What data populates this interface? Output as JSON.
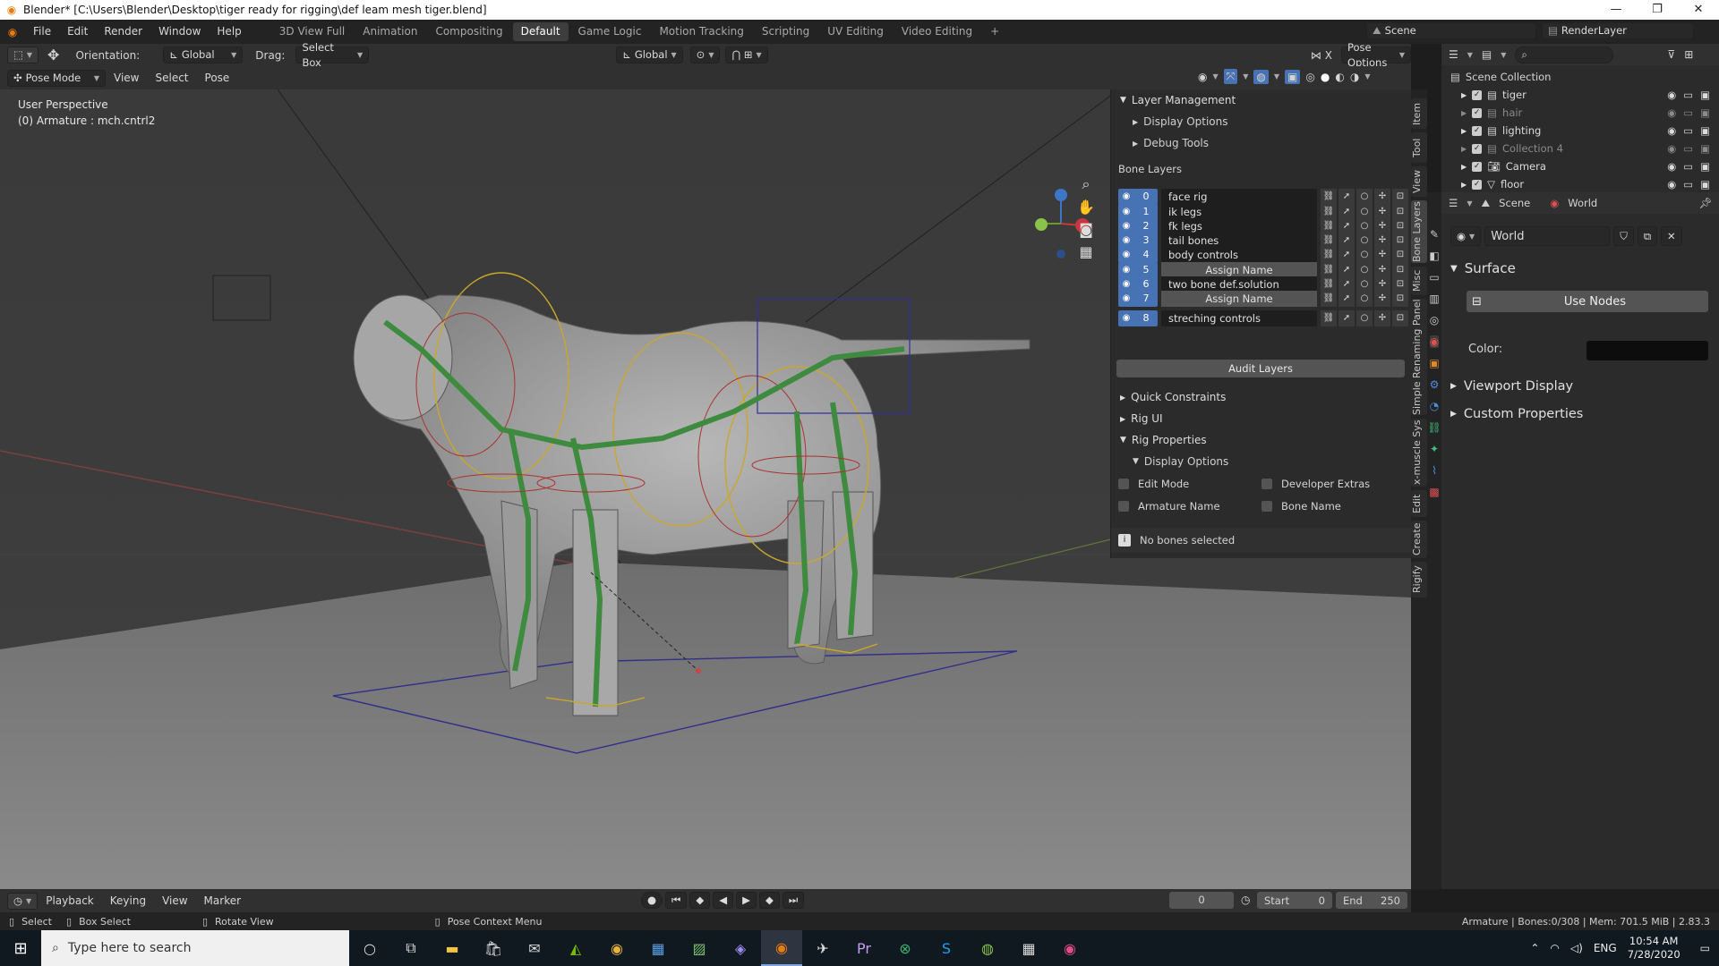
{
  "window": {
    "title": "Blender* [C:\\Users\\Blender\\Desktop\\tiger ready for rigging\\def leam mesh tiger.blend]",
    "minimize": "—",
    "maximize": "❐",
    "close": "✕"
  },
  "menu": [
    "File",
    "Edit",
    "Render",
    "Window",
    "Help"
  ],
  "workspaces": [
    "3D View Full",
    "Animation",
    "Compositing",
    "Default",
    "Game Logic",
    "Motion Tracking",
    "Scripting",
    "UV Editing",
    "Video Editing"
  ],
  "active_workspace": "Default",
  "scene_selector": {
    "scene": "Scene",
    "view_layer": "RenderLayer"
  },
  "tool_header": {
    "orientation_label": "Orientation:",
    "orientation_value": "Global",
    "drag_label": "Drag:",
    "drag_value": "Select Box",
    "transform_orientation": "Global",
    "pose_options": "Pose Options"
  },
  "mode_header": {
    "mode": "Pose Mode",
    "view": "View",
    "select": "Select",
    "pose": "Pose"
  },
  "viewport": {
    "perspective": "User Perspective",
    "active": "(0) Armature : mch.cntrl2"
  },
  "n_panel": {
    "layer_management": "Layer Management",
    "display_options": "Display Options",
    "debug_tools": "Debug Tools",
    "bone_layers_title": "Bone Layers",
    "layers": [
      {
        "num": "0",
        "name": "face rig",
        "assign": false
      },
      {
        "num": "1",
        "name": "ik legs",
        "assign": false
      },
      {
        "num": "2",
        "name": "fk legs",
        "assign": false
      },
      {
        "num": "3",
        "name": "tail bones",
        "assign": false
      },
      {
        "num": "4",
        "name": "body controls",
        "assign": false
      },
      {
        "num": "5",
        "name": "Assign Name",
        "assign": true
      },
      {
        "num": "6",
        "name": "two bone def.solution",
        "assign": false
      },
      {
        "num": "7",
        "name": "Assign Name",
        "assign": true
      },
      {
        "num": "8",
        "name": "streching controls",
        "assign": false
      }
    ],
    "audit_layers": "Audit Layers",
    "quick_constraints": "Quick Constraints",
    "rig_ui": "Rig UI",
    "rig_properties": "Rig Properties",
    "rig_display_options": "Display Options",
    "edit_mode": "Edit Mode",
    "developer_extras": "Developer Extras",
    "armature_name": "Armature Name",
    "bone_name": "Bone Name",
    "no_bones": "No bones selected"
  },
  "side_tabs": [
    "Item",
    "Tool",
    "View",
    "Bone Layers",
    "Misc",
    "Simple Renaming Panel",
    "x-muscle Sys",
    "Edit",
    "Create",
    "Rigify"
  ],
  "outliner": {
    "root": "Scene Collection",
    "items": [
      {
        "name": "tiger",
        "dim": false
      },
      {
        "name": "hair",
        "dim": true
      },
      {
        "name": "lighting",
        "dim": false
      },
      {
        "name": "Collection 4",
        "dim": true
      },
      {
        "name": "Camera",
        "dim": false
      },
      {
        "name": "floor",
        "dim": false
      }
    ]
  },
  "properties": {
    "breadcrumb_scene": "Scene",
    "breadcrumb_world": "World",
    "world_name": "World",
    "surface": "Surface",
    "use_nodes": "Use Nodes",
    "color_label": "Color:",
    "viewport_display": "Viewport Display",
    "custom_properties": "Custom Properties"
  },
  "timeline": {
    "playback": "Playback",
    "keying": "Keying",
    "view": "View",
    "marker": "Marker",
    "current_frame": "0",
    "start_label": "Start",
    "start": "0",
    "end_label": "End",
    "end": "250"
  },
  "status": {
    "select": "Select",
    "box_select": "Box Select",
    "rotate_view": "Rotate View",
    "context_menu": "Pose Context Menu",
    "stats": "Armature | Bones:0/308 | Mem: 701.5 MiB | 2.83.3"
  },
  "taskbar": {
    "search_placeholder": "Type here to search",
    "lang": "ENG",
    "time": "10:54 AM",
    "date": "7/28/2020"
  },
  "colors": {
    "accent": "#4772b3",
    "world_color": "#0d0d0d"
  }
}
